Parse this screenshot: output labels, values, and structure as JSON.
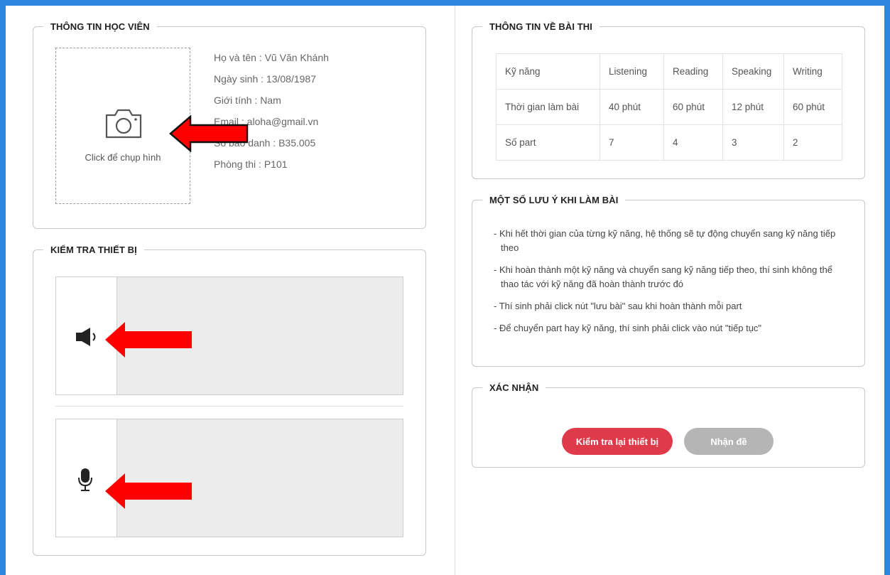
{
  "student": {
    "legend": "THÔNG TIN HỌC VIÊN",
    "photo_caption": "Click để chụp hình",
    "fields": [
      "Họ và tên : Vũ Văn Khánh",
      "Ngày sinh : 13/08/1987",
      "Giới tính : Nam",
      "Email : aloha@gmail.vn",
      "Số báo danh : B35.005",
      "Phòng thi : P101"
    ]
  },
  "device": {
    "legend": "KIỂM TRA THIẾT BỊ"
  },
  "exam": {
    "legend": "THÔNG TIN VỀ BÀI THI",
    "rows": [
      [
        "Kỹ năng",
        "Listening",
        "Reading",
        "Speaking",
        "Writing"
      ],
      [
        "Thời gian làm bài",
        "40 phút",
        "60 phút",
        "12 phút",
        "60 phút"
      ],
      [
        "Số part",
        "7",
        "4",
        "3",
        "2"
      ]
    ]
  },
  "notes": {
    "legend": "MỘT SỐ LƯU Ý KHI LÀM BÀI",
    "items": [
      "- Khi hết thời gian của từng kỹ năng, hệ thống sẽ tự động chuyển sang kỹ năng tiếp theo",
      "- Khi hoàn thành một kỹ năng và chuyển sang kỹ năng tiếp theo, thí sinh không thể thao tác với kỹ năng đã hoàn thành trước đó",
      "- Thí sinh phải click nút \"lưu bài\" sau khi hoàn thành mỗi part",
      "- Để chuyển part hay kỹ năng, thí sinh phải click vào nút \"tiếp tục\""
    ]
  },
  "confirm": {
    "legend": "XÁC NHẬN",
    "recheck_label": "Kiểm tra lại thiết bị",
    "get_exam_label": "Nhận đề"
  },
  "colors": {
    "primary_button": "#df3a4a",
    "disabled_button": "#b5b5b5",
    "annotation_arrow": "#ff0000",
    "background": "#2f86e0"
  },
  "icons": [
    "camera-icon",
    "speaker-icon",
    "microphone-icon"
  ]
}
